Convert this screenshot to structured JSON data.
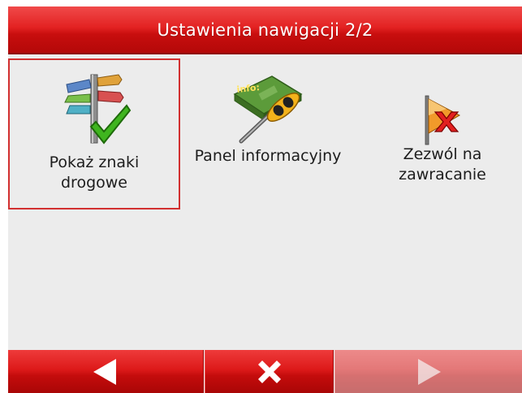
{
  "header": {
    "title": "Ustawienia nawigacji 2/2"
  },
  "tiles": [
    {
      "label": "Pokaż znaki drogowe",
      "icon": "road-signs-check-icon",
      "selected": true
    },
    {
      "label": "Panel informacyjny",
      "icon": "info-panel-screwdriver-icon",
      "selected": false
    },
    {
      "label": "Zezwól na zawracanie",
      "icon": "u-turn-forbidden-icon",
      "selected": false
    }
  ],
  "footer": {
    "back_icon": "arrow-left-icon",
    "close_icon": "close-x-icon",
    "next_icon": "arrow-right-icon",
    "next_enabled": false
  },
  "colors": {
    "accent_red": "#dd1a1a",
    "background": "#ececec",
    "selection_border": "#d23030"
  }
}
